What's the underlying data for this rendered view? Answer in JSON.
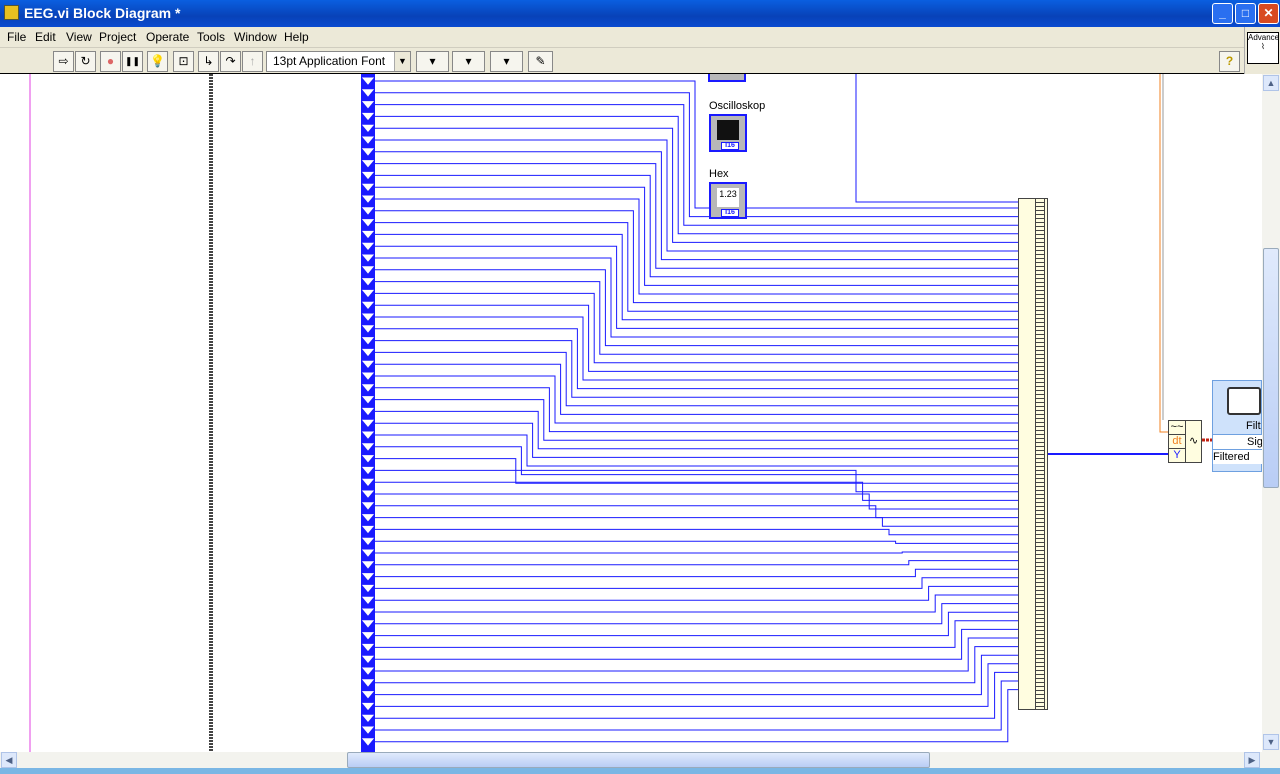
{
  "window": {
    "title": "EEG.vi Block Diagram *",
    "minimize": "_",
    "maximize": "□",
    "close": "✕"
  },
  "menu": [
    "File",
    "Edit",
    "View",
    "Project",
    "Operate",
    "Tools",
    "Window",
    "Help"
  ],
  "toolbar": {
    "font": "13pt Application Font",
    "run": "⇨",
    "run_cont": "↻",
    "abort": "●",
    "pause": "❚❚",
    "highlight": "💡",
    "retain": "⊡",
    "step_into": "↳",
    "step_over": "↷",
    "step_out": "↑",
    "align": "▾",
    "distribute": "▾",
    "reorder": "▾",
    "cleanup": "✎",
    "help": "?"
  },
  "context_help": {
    "label": "Advance"
  },
  "nodes": {
    "oscilloskop": "Oscilloskop",
    "hex": "Hex",
    "hex_value": "1.23",
    "tag": "I16"
  },
  "waveform": {
    "wave": "~~",
    "dt": "dt",
    "y": "Y"
  },
  "express_vi": {
    "title": "Filt",
    "signal": "Sig",
    "filtered": "Filtered"
  },
  "colors": {
    "wire": "#1a1aff",
    "accent": "#0842b8"
  }
}
